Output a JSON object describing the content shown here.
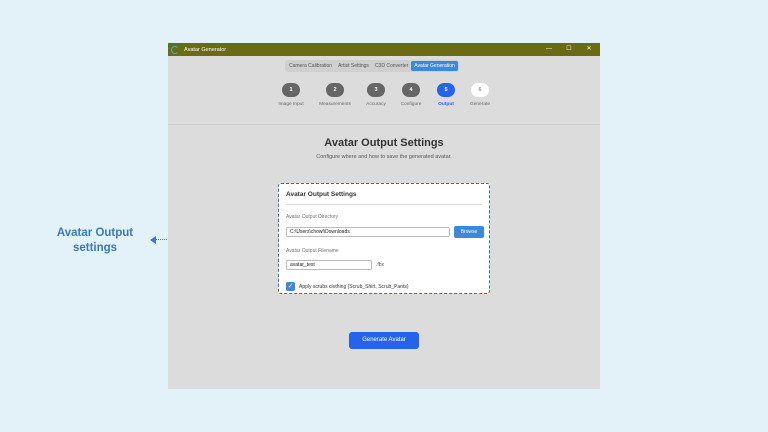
{
  "annotation": {
    "text_line1": "Avatar Output",
    "text_line2": "settings"
  },
  "window": {
    "title": "Avatar Generator",
    "controls": [
      "—",
      "☐",
      "✕"
    ]
  },
  "tabs": [
    {
      "label": "Camera Calibration",
      "active": false
    },
    {
      "label": "Artist Settings",
      "active": false
    },
    {
      "label": "C3D Converter",
      "active": false
    },
    {
      "label": "Avatar Generation",
      "active": true
    }
  ],
  "steps": [
    {
      "num": "1",
      "label": "Image Input",
      "state": "done"
    },
    {
      "num": "2",
      "label": "Measurements",
      "state": "done"
    },
    {
      "num": "3",
      "label": "Accuracy",
      "state": "done"
    },
    {
      "num": "4",
      "label": "Configure",
      "state": "done"
    },
    {
      "num": "5",
      "label": "Output",
      "state": "current"
    },
    {
      "num": "6",
      "label": "Generate",
      "state": "pending"
    }
  ],
  "page": {
    "title": "Avatar Output Settings",
    "subtitle": "Configure where and how to save the generated avatar."
  },
  "card": {
    "title": "Avatar Output Settings",
    "dir_label": "Avatar Output Directory",
    "dir_value": "C:\\Users\\chowl\\Downloads",
    "browse_label": "Browse",
    "filename_label": "Avatar Output Filename",
    "filename_value": "avatar_test",
    "extension": ".fbx",
    "checkbox_label": "Apply scrubs clothing (Scrub_Shirt, Scrub_Pants)",
    "checkbox_checked": true
  },
  "generate_button": "Generate Avatar",
  "colors": {
    "accent": "#2563eb",
    "titlebar": "#6b6b16",
    "annotation": "#3a7bb8"
  }
}
